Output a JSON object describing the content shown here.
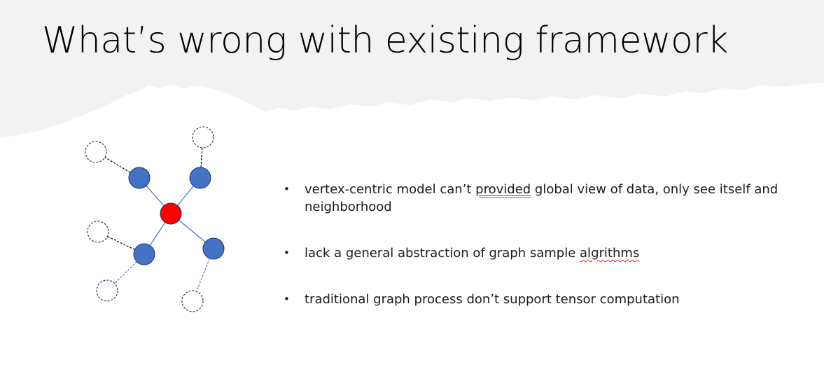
{
  "slide": {
    "title": "What’s wrong with existing framework",
    "colors": {
      "header_band": "#f2f2f2",
      "background": "#ffffff",
      "center_node": "#ff0000",
      "neighbor_node": "#4472c4",
      "node_border": "#1f3864",
      "edge_solid": "#4472c4",
      "edge_dashed_black": "#000000",
      "edge_dashed_blue": "#4472c4",
      "grammar_mark": "#4472c4",
      "spelling_mark": "#e0261b"
    }
  },
  "graph": {
    "center_node": {
      "fill": "red"
    },
    "neighbor_nodes": 4,
    "unseen_nodes": 5,
    "unseen_node_style": "dashed outline"
  },
  "bullets": [
    {
      "symbol": "•",
      "text_parts": [
        "vertex-centric model can’t ",
        "provided",
        " global view of data, only see itself and neighborhood"
      ]
    },
    {
      "symbol": "•",
      "text_parts": [
        "lack a general abstraction of graph sample ",
        "algrithms",
        ""
      ]
    },
    {
      "symbol": "•",
      "text_parts": [
        "traditional graph process don’t support tensor computation"
      ]
    }
  ]
}
